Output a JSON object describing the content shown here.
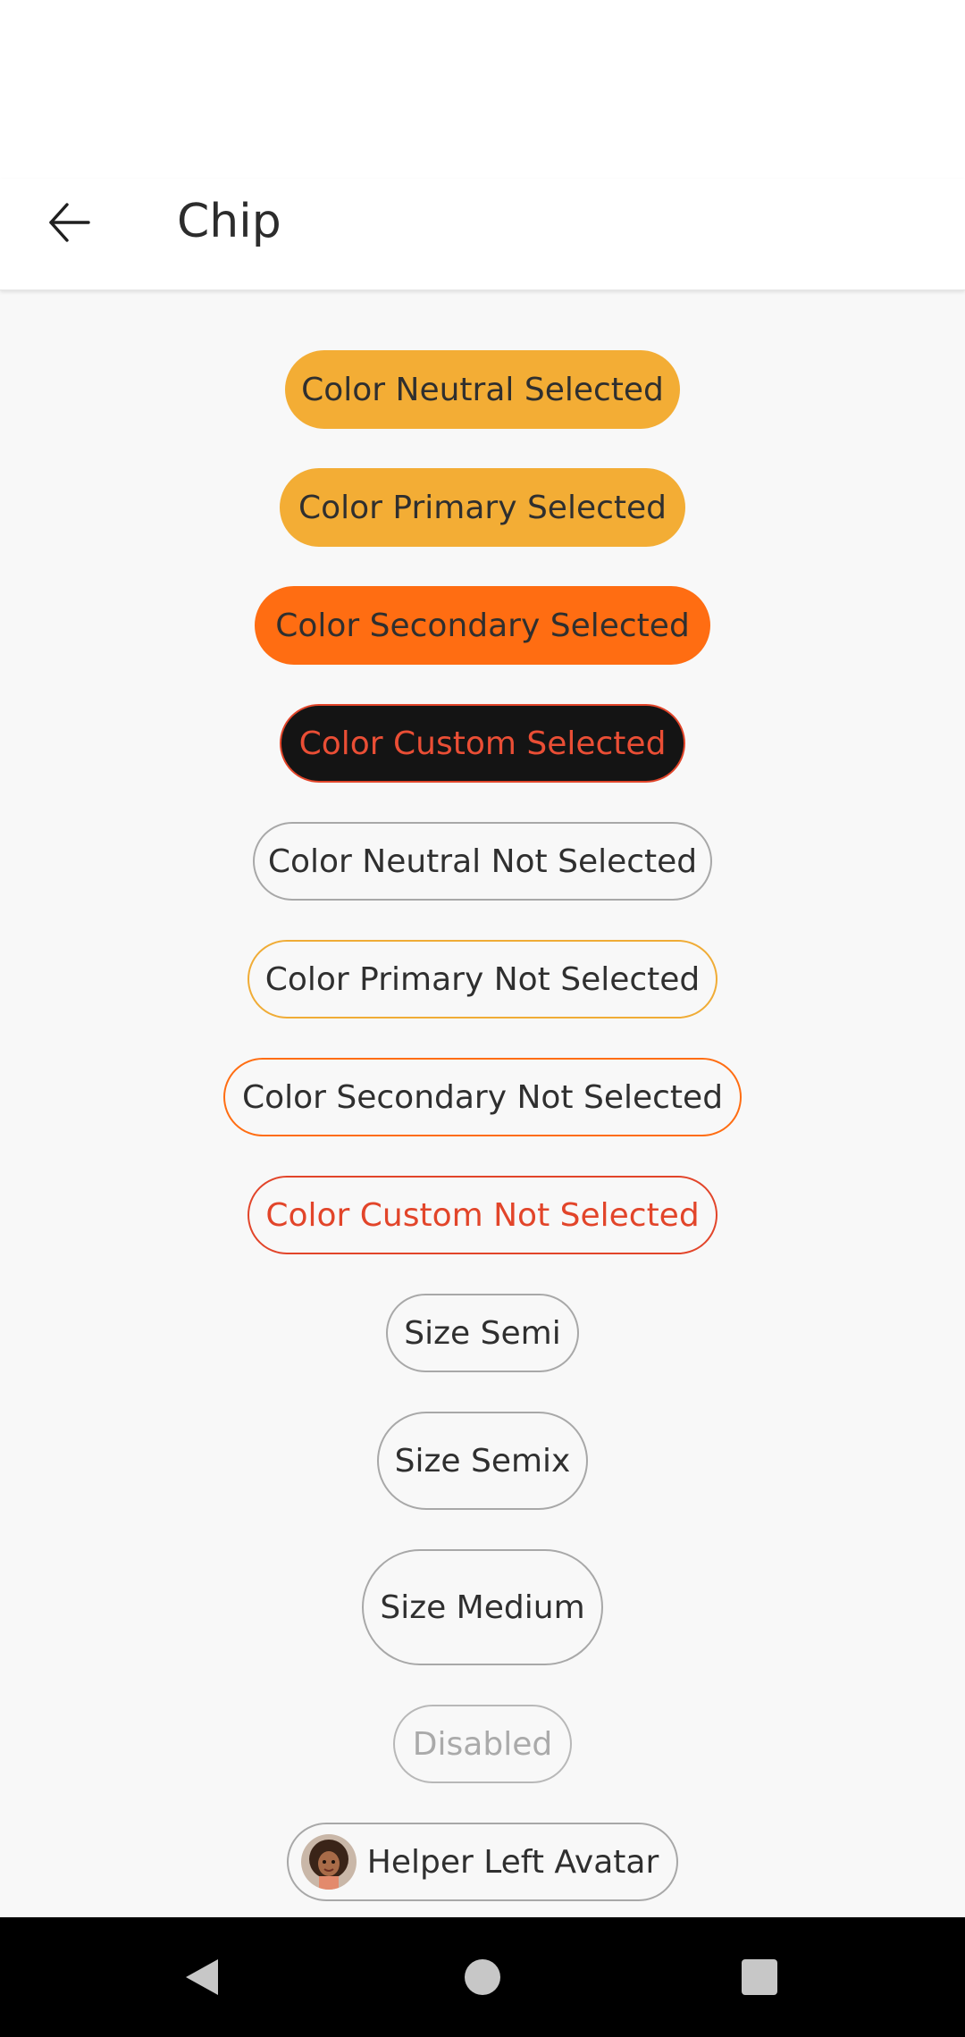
{
  "app_bar": {
    "title": "Chip",
    "back_icon": "arrow-left-icon"
  },
  "chips": [
    {
      "label": "Color Neutral Selected"
    },
    {
      "label": "Color Primary Selected"
    },
    {
      "label": "Color Secondary Selected"
    },
    {
      "label": "Color Custom Selected"
    },
    {
      "label": "Color Neutral Not Selected"
    },
    {
      "label": "Color Primary Not Selected"
    },
    {
      "label": "Color Secondary Not Selected"
    },
    {
      "label": "Color Custom Not Selected"
    },
    {
      "label": "Size Semi"
    },
    {
      "label": "Size Semix"
    },
    {
      "label": "Size Medium"
    },
    {
      "label": "Disabled"
    },
    {
      "label": "Helper Left Avatar",
      "icon": "avatar"
    }
  ],
  "colors": {
    "primary": "#f3ad35",
    "secondary": "#ff6d12",
    "custom_text": "#e2452a",
    "custom_bg": "#141414",
    "neutral_border": "#a8a8a8"
  },
  "nav_bar": {
    "back_icon": "triangle-back-icon",
    "home_icon": "circle-home-icon",
    "recents_icon": "square-recents-icon"
  }
}
